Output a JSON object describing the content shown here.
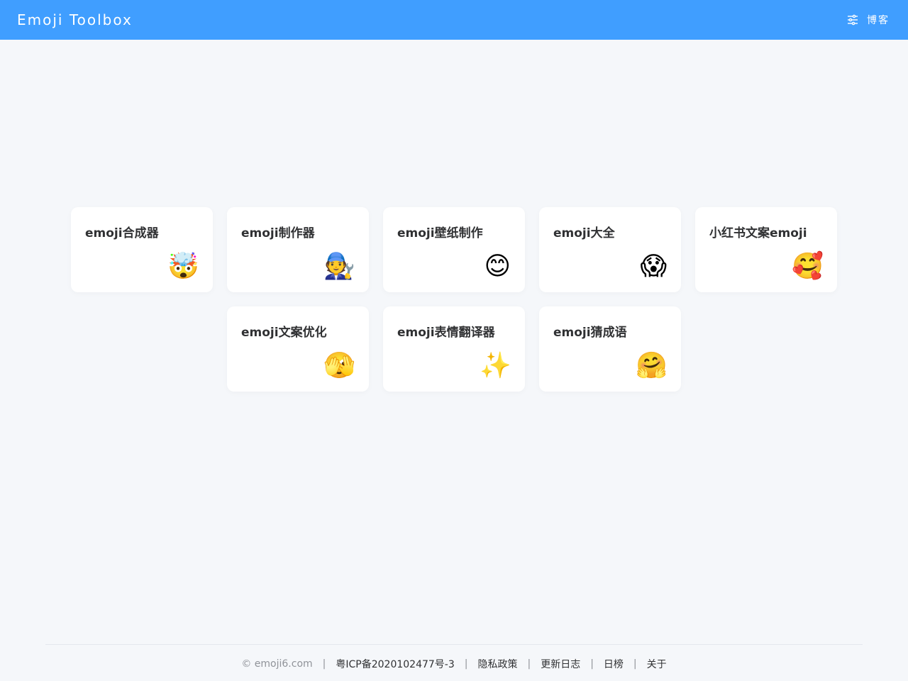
{
  "header": {
    "brand": "Emoji Toolbox",
    "nav_label": "博客",
    "nav_icon": "sliders-icon",
    "bg_color": "#409eff"
  },
  "cards": [
    {
      "title": "emoji合成器",
      "emoji": "🤯"
    },
    {
      "title": "emoji制作器",
      "emoji": "🧑‍🔧"
    },
    {
      "title": "emoji壁纸制作",
      "emoji": "😊"
    },
    {
      "title": "emoji大全",
      "emoji": "😱"
    },
    {
      "title": "小红书文案emoji",
      "emoji": "🥰"
    },
    {
      "title": "emoji文案优化",
      "emoji": "🫣"
    },
    {
      "title": "emoji表情翻译器",
      "emoji": "✨"
    },
    {
      "title": "emoji猜成语",
      "emoji": "🤗"
    }
  ],
  "footer": {
    "copyright": "© emoji6.com",
    "icp": "粤ICP备2020102477号-3",
    "privacy": "隐私政策",
    "changelog": "更新日志",
    "rank": "日榜",
    "about": "关于",
    "separator": "|"
  }
}
